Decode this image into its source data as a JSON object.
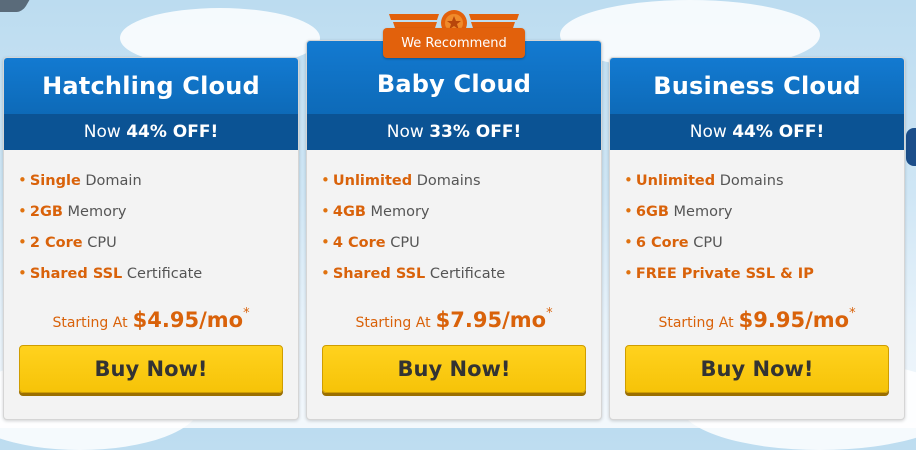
{
  "badge": {
    "label": "We Recommend",
    "icon": "star-icon"
  },
  "colors": {
    "header_blue": "#137ad1",
    "discount_band": "#0b5394",
    "highlight_orange": "#d9620a",
    "button_yellow": "#ffd21e",
    "badge_orange": "#e2610c"
  },
  "plans": [
    {
      "title": "Hatchling Cloud",
      "discount_prefix": "Now",
      "discount": "44% OFF!",
      "features": [
        {
          "highlight": "Single",
          "text": " Domain"
        },
        {
          "highlight": "2GB",
          "text": " Memory"
        },
        {
          "highlight": "2 Core",
          "text": " CPU"
        },
        {
          "highlight": "Shared SSL",
          "text": " Certificate"
        }
      ],
      "price_label": "Starting At",
      "price": "$4.95/mo",
      "price_note": "*",
      "button": "Buy Now!"
    },
    {
      "title": "Baby Cloud",
      "discount_prefix": "Now",
      "discount": "33% OFF!",
      "features": [
        {
          "highlight": "Unlimited",
          "text": " Domains"
        },
        {
          "highlight": "4GB",
          "text": " Memory"
        },
        {
          "highlight": "4 Core",
          "text": " CPU"
        },
        {
          "highlight": "Shared SSL",
          "text": " Certificate"
        }
      ],
      "price_label": "Starting At",
      "price": "$7.95/mo",
      "price_note": "*",
      "button": "Buy Now!"
    },
    {
      "title": "Business Cloud",
      "discount_prefix": "Now",
      "discount": "44% OFF!",
      "features": [
        {
          "highlight": "Unlimited",
          "text": " Domains"
        },
        {
          "highlight": "6GB",
          "text": " Memory"
        },
        {
          "highlight": "6 Core",
          "text": " CPU"
        },
        {
          "highlight": "FREE Private SSL & IP",
          "text": ""
        }
      ],
      "price_label": "Starting At",
      "price": "$9.95/mo",
      "price_note": "*",
      "button": "Buy Now!"
    }
  ]
}
